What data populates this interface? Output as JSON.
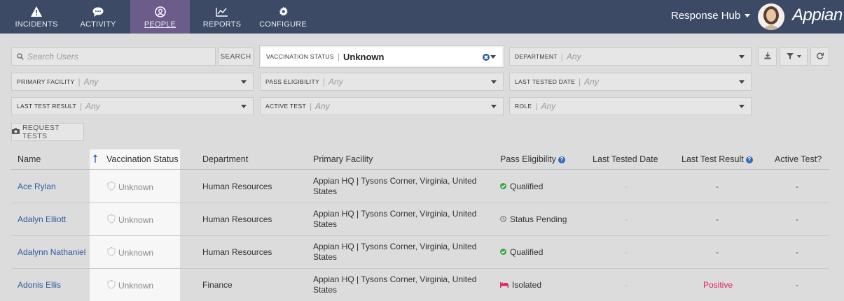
{
  "nav": {
    "items": [
      {
        "label": "INCIDENTS",
        "icon": "alert-icon"
      },
      {
        "label": "ACTIVITY",
        "icon": "chat-icon"
      },
      {
        "label": "PEOPLE",
        "icon": "user-icon"
      },
      {
        "label": "REPORTS",
        "icon": "chart-icon"
      },
      {
        "label": "CONFIGURE",
        "icon": "gear-icon"
      }
    ],
    "active": "PEOPLE",
    "hub_label": "Response Hub",
    "brand": "Appian"
  },
  "filters": {
    "search_placeholder": "Search Users",
    "search_button": "SEARCH",
    "vaccination": {
      "label": "VACCINATION STATUS",
      "value": "Unknown"
    },
    "department": {
      "label": "DEPARTMENT",
      "value": "Any"
    },
    "primary_facility": {
      "label": "PRIMARY FACILITY",
      "value": "Any"
    },
    "pass_eligibility": {
      "label": "PASS ELIGIBILITY",
      "value": "Any"
    },
    "last_tested_date": {
      "label": "LAST TESTED DATE",
      "value": "Any"
    },
    "last_test_result": {
      "label": "LAST TEST RESULT",
      "value": "Any"
    },
    "active_test": {
      "label": "ACTIVE TEST",
      "value": "Any"
    },
    "role": {
      "label": "ROLE",
      "value": "Any"
    },
    "request_tests": "REQUEST TESTS"
  },
  "table": {
    "headers": {
      "name": "Name",
      "vaccination": "Vaccination Status",
      "department": "Department",
      "facility": "Primary Facility",
      "eligibility": "Pass Eligibility",
      "last_tested": "Last Tested Date",
      "last_result": "Last Test Result",
      "active_test": "Active Test?"
    },
    "rows": [
      {
        "name": "Ace Rylan",
        "vaccination": "Unknown",
        "department": "Human Resources",
        "facility": "Appian HQ | Tysons Corner, Virginia, United States",
        "eligibility": "Qualified",
        "eligibility_status": "qualified",
        "last_tested": "-",
        "last_result": "-",
        "active_test": "-"
      },
      {
        "name": "Adalyn Elliott",
        "vaccination": "Unknown",
        "department": "Human Resources",
        "facility": "Appian HQ | Tysons Corner, Virginia, United States",
        "eligibility": "Status Pending",
        "eligibility_status": "pending",
        "last_tested": "-",
        "last_result": "-",
        "active_test": "-"
      },
      {
        "name": "Adalynn Nathaniel",
        "vaccination": "Unknown",
        "department": "Human Resources",
        "facility": "Appian HQ | Tysons Corner, Virginia, United States",
        "eligibility": "Qualified",
        "eligibility_status": "qualified",
        "last_tested": "-",
        "last_result": "-",
        "active_test": "-"
      },
      {
        "name": "Adonis Ellis",
        "vaccination": "Unknown",
        "department": "Finance",
        "facility": "Appian HQ | Tysons Corner, Virginia, United States",
        "eligibility": "Isolated",
        "eligibility_status": "isolated",
        "last_tested": "-",
        "last_result": "Positive",
        "active_test": "-"
      }
    ]
  },
  "colors": {
    "nav_bg": "#3c4a66",
    "nav_active": "#6b5c8c",
    "link": "#2e5f9c",
    "positive": "#e0255c",
    "qualified": "#3aa845"
  }
}
